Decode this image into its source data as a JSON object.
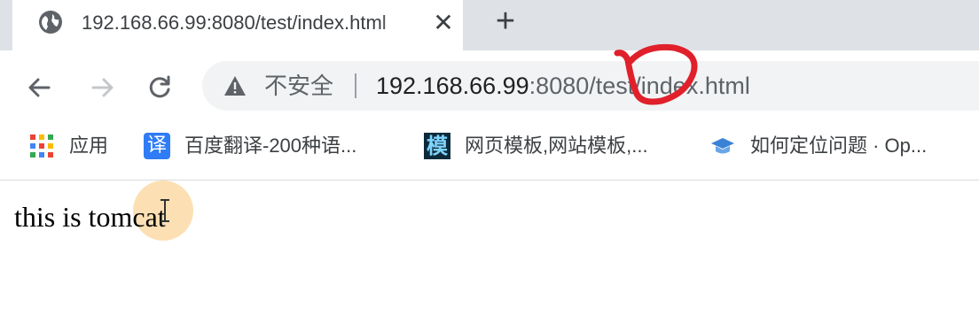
{
  "tab": {
    "title": "192.168.66.99:8080/test/index.html",
    "close_glyph": "✕",
    "favicon": "globe-icon"
  },
  "new_tab": {
    "glyph": "+"
  },
  "toolbar": {
    "back": "arrow-left-icon",
    "forward": "arrow-right-icon",
    "reload": "reload-icon"
  },
  "omnibox": {
    "security_label": "不安全",
    "url_host": "192.168.66.99",
    "url_port": ":8080",
    "url_path": "/test/index.html"
  },
  "bookmarks": [
    {
      "icon": "apps-grid-icon",
      "label": "应用"
    },
    {
      "icon": "translate-icon",
      "icon_char": "译",
      "label": "百度翻译-200种语..."
    },
    {
      "icon": "template-icon",
      "icon_char": "模",
      "label": "网页模板,网站模板,..."
    },
    {
      "icon": "graduation-cap-icon",
      "label": "如何定位问题 · Op..."
    }
  ],
  "page": {
    "text": "this is tomcat"
  },
  "colors": {
    "tabstrip": "#dee1e6",
    "omnibox": "#f1f3f4",
    "annotation_red": "#e0202a",
    "cursor_highlight": "#fbd08c"
  }
}
